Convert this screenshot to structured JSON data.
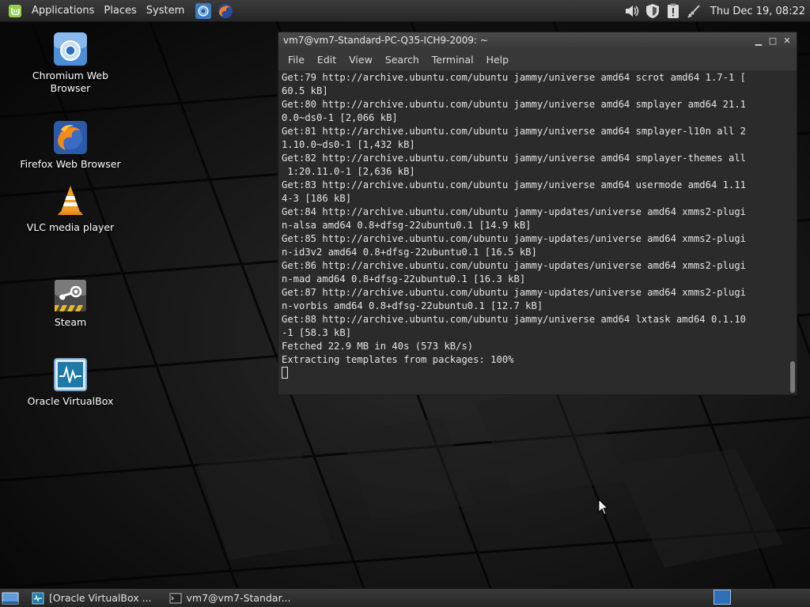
{
  "top_panel": {
    "menu_applications": "Applications",
    "menu_places": "Places",
    "menu_system": "System",
    "clock": "Thu Dec 19, 08:22"
  },
  "desktop_icons": [
    {
      "label": "Chromium Web Browser",
      "icon": "chromium-icon"
    },
    {
      "label": "Firefox Web Browser",
      "icon": "firefox-icon"
    },
    {
      "label": "VLC media player",
      "icon": "vlc-icon"
    },
    {
      "label": "Steam",
      "icon": "steam-icon"
    },
    {
      "label": "Oracle VirtualBox",
      "icon": "virtualbox-icon"
    }
  ],
  "terminal": {
    "title": "vm7@vm7-Standard-PC-Q35-ICH9-2009: ~",
    "menu": [
      "File",
      "Edit",
      "View",
      "Search",
      "Terminal",
      "Help"
    ],
    "lines": [
      "Get:79 http://archive.ubuntu.com/ubuntu jammy/universe amd64 scrot amd64 1.7-1 [",
      "60.5 kB]",
      "Get:80 http://archive.ubuntu.com/ubuntu jammy/universe amd64 smplayer amd64 21.1",
      "0.0~ds0-1 [2,066 kB]",
      "Get:81 http://archive.ubuntu.com/ubuntu jammy/universe amd64 smplayer-l10n all 2",
      "1.10.0~ds0-1 [1,432 kB]",
      "Get:82 http://archive.ubuntu.com/ubuntu jammy/universe amd64 smplayer-themes all",
      " 1:20.11.0-1 [2,636 kB]",
      "Get:83 http://archive.ubuntu.com/ubuntu jammy/universe amd64 usermode amd64 1.11",
      "4-3 [186 kB]",
      "Get:84 http://archive.ubuntu.com/ubuntu jammy-updates/universe amd64 xmms2-plugi",
      "n-alsa amd64 0.8+dfsg-22ubuntu0.1 [14.9 kB]",
      "Get:85 http://archive.ubuntu.com/ubuntu jammy-updates/universe amd64 xmms2-plugi",
      "n-id3v2 amd64 0.8+dfsg-22ubuntu0.1 [16.5 kB]",
      "Get:86 http://archive.ubuntu.com/ubuntu jammy-updates/universe amd64 xmms2-plugi",
      "n-mad amd64 0.8+dfsg-22ubuntu0.1 [16.3 kB]",
      "Get:87 http://archive.ubuntu.com/ubuntu jammy-updates/universe amd64 xmms2-plugi",
      "n-vorbis amd64 0.8+dfsg-22ubuntu0.1 [12.7 kB]",
      "Get:88 http://archive.ubuntu.com/ubuntu jammy/universe amd64 lxtask amd64 0.1.10",
      "-1 [58.3 kB]",
      "Fetched 22.9 MB in 40s (573 kB/s)",
      "Extracting templates from packages: 100%"
    ]
  },
  "taskbar": {
    "tasks": [
      {
        "label": "[Oracle VirtualBox ...",
        "icon": "virtualbox-icon"
      },
      {
        "label": "vm7@vm7-Standar...",
        "icon": "terminal-icon"
      }
    ]
  },
  "colors": {
    "panel": "#2f2f2f",
    "terminal_bg": "#2b2b2b",
    "terminal_fg": "#e5e5e5",
    "workspace_active": "#2f6fb8"
  }
}
